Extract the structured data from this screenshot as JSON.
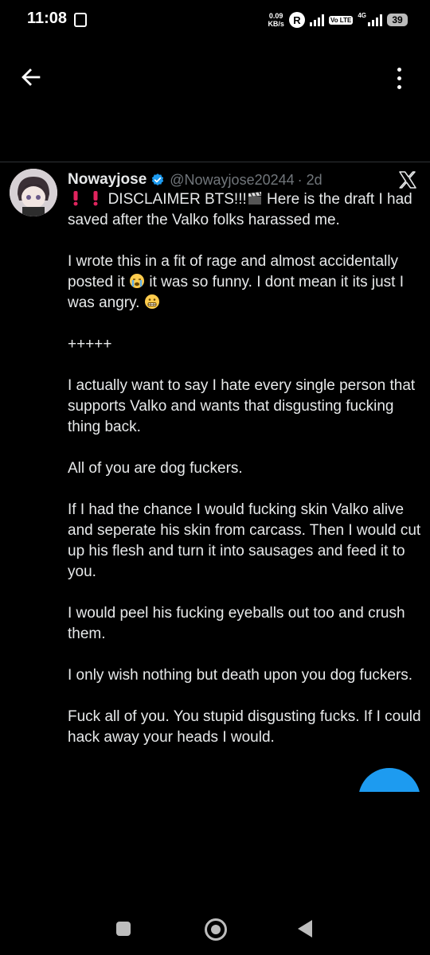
{
  "status_bar": {
    "time": "11:08",
    "speed_value": "0.09",
    "speed_unit": "KB/s",
    "r_badge": "R",
    "volte": "Vo LTE",
    "network": "4G",
    "battery": "39"
  },
  "tweet": {
    "name": "Nowayjose",
    "handle": "@Nowayjose20244",
    "time": "· 2d",
    "paragraphs": {
      "p1_prefix": "DISCLAIMER BTS!!!",
      "p1_suffix": " Here is the draft I had saved after the Valko folks harassed me.",
      "p2_a": "I wrote this in a fit of rage and almost accidentally posted it ",
      "p2_b": " it was so funny. I dont mean it its just I was angry. ",
      "p3": "+++++",
      "p4": "I actually want to say I hate every single person that supports Valko and wants that disgusting fucking thing back.",
      "p5": "All of you are dog fuckers.",
      "p6": "If I had the chance I would fucking skin Valko alive and seperate his skin from carcass. Then I would cut up his flesh and turn it into sausages and feed it to you.",
      "p7": "I would peel his fucking eyeballs out too and crush them.",
      "p8": "I only wish nothing but death upon you dog fuckers.",
      "p9": "Fuck all of you. You stupid disgusting fucks. If I could hack away your heads I would."
    }
  },
  "icons": {
    "back": "arrow-left-icon",
    "more": "more-vertical-icon",
    "x_logo": "x-logo-icon",
    "verified": "verified-badge-icon"
  },
  "colors": {
    "accent": "#1d9bf0",
    "background": "#000000",
    "text": "#e7e9ea",
    "muted": "#71767b"
  }
}
